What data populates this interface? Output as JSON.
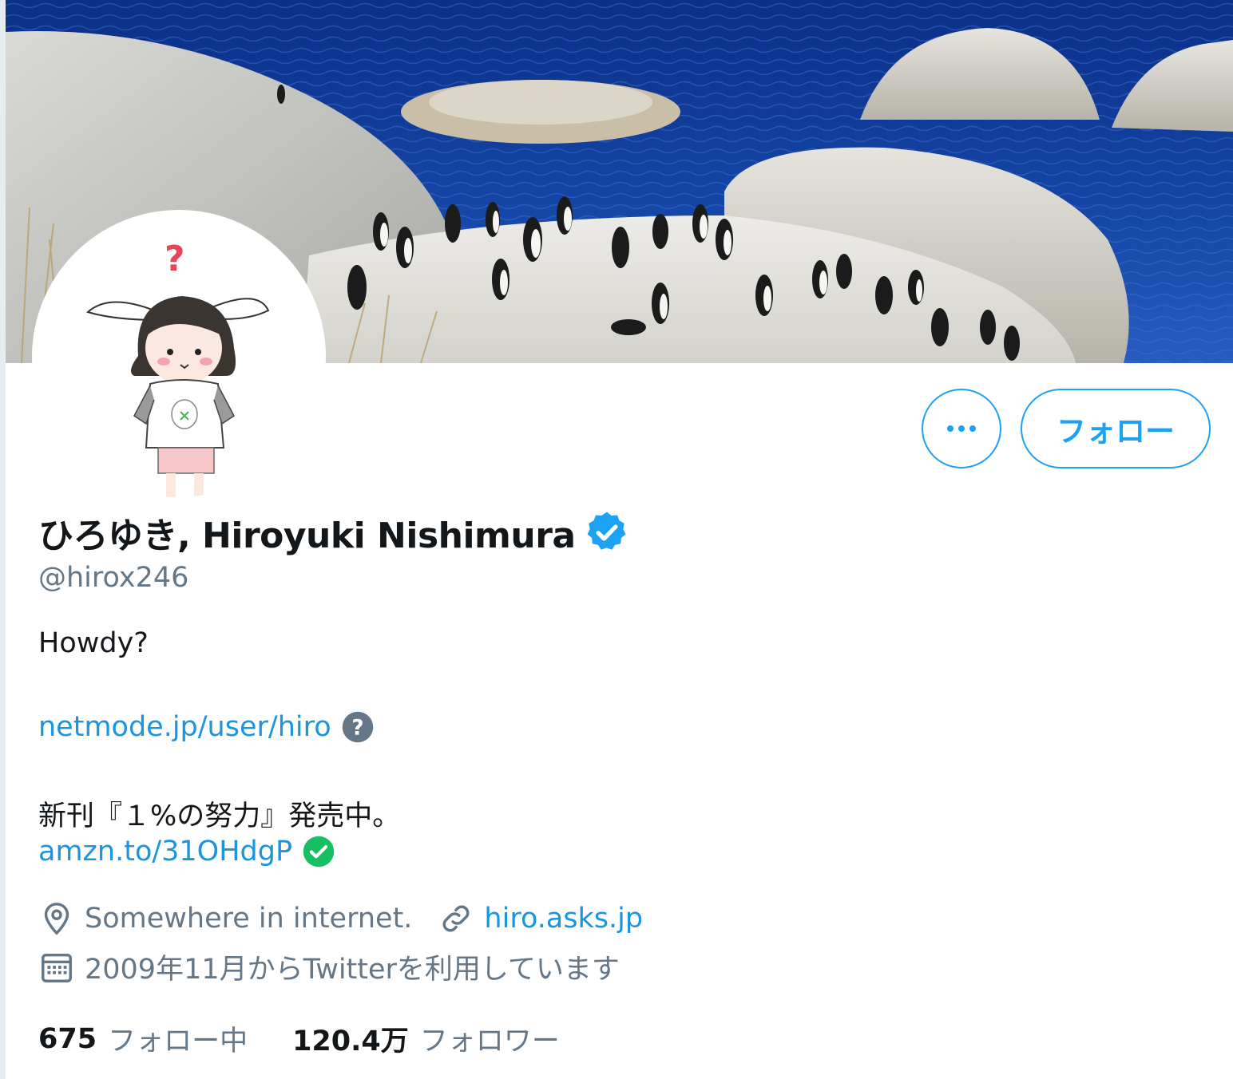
{
  "profile": {
    "display_name": "ひろゆき, Hiroyuki Nishimura",
    "handle": "@hirox246",
    "verified_icon": "verified-badge-icon",
    "follow_label": "フォロー",
    "more_icon": "more-dots-icon"
  },
  "bio": {
    "greeting": "Howdy?",
    "link1": "netmode.jp/user/hiro",
    "link1_icon": "question-circle-icon",
    "book_line": "新刊『１%の努力』発売中。",
    "link2": "amzn.to/31OHdgP",
    "link2_icon": "check-circle-icon"
  },
  "meta": {
    "location_icon": "location-pin-icon",
    "location": "Somewhere in internet.",
    "website_icon": "link-icon",
    "website": "hiro.asks.jp",
    "joined_icon": "calendar-icon",
    "joined": "2009年11月からTwitterを利用しています"
  },
  "stats": {
    "following_count": "675",
    "following_label": "フォロー中",
    "followers_count": "120.4万",
    "followers_label": "フォロワー"
  },
  "colors": {
    "accent": "#1da1f2",
    "link": "#1b95e0",
    "secondary_text": "#657786",
    "verified": "#1da1f2",
    "safe_check": "#17bf63",
    "help_gray": "#657786"
  },
  "images": {
    "banner": "penguins-on-rocks-banner",
    "avatar": "bunny-ear-girl-avatar"
  }
}
